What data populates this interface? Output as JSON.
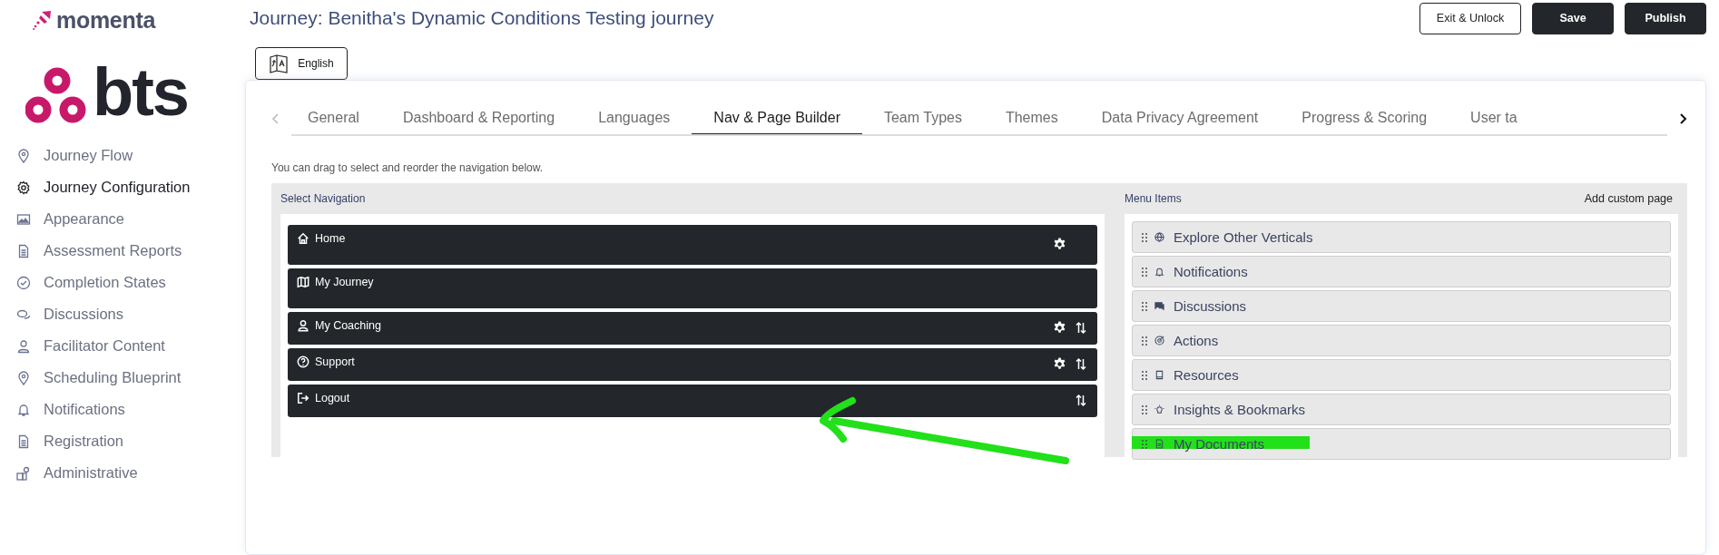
{
  "brand": {
    "product": "momenta",
    "client": "bts"
  },
  "sidebar": {
    "items": [
      {
        "label": "Journey Flow",
        "selected": false
      },
      {
        "label": "Journey Configuration",
        "selected": true
      },
      {
        "label": "Appearance",
        "selected": false
      },
      {
        "label": "Assessment Reports",
        "selected": false
      },
      {
        "label": "Completion States",
        "selected": false
      },
      {
        "label": "Discussions",
        "selected": false
      },
      {
        "label": "Facilitator Content",
        "selected": false
      },
      {
        "label": "Scheduling Blueprint",
        "selected": false
      },
      {
        "label": "Notifications",
        "selected": false
      },
      {
        "label": "Registration",
        "selected": false
      },
      {
        "label": "Administrative",
        "selected": false
      }
    ]
  },
  "header": {
    "title": "Journey: Benitha's Dynamic Conditions Testing journey",
    "buttons": [
      {
        "label": "Exit & Unlock",
        "kind": "outline"
      },
      {
        "label": "Save",
        "kind": "solid"
      },
      {
        "label": "Publish",
        "kind": "solid"
      }
    ]
  },
  "language_button": {
    "label": "English"
  },
  "tabs": [
    {
      "label": "General",
      "selected": false
    },
    {
      "label": "Dashboard & Reporting",
      "selected": false
    },
    {
      "label": "Languages",
      "selected": false
    },
    {
      "label": "Nav & Page Builder",
      "selected": true
    },
    {
      "label": "Team Types",
      "selected": false
    },
    {
      "label": "Themes",
      "selected": false
    },
    {
      "label": "Data Privacy Agreement",
      "selected": false
    },
    {
      "label": "Progress & Scoring",
      "selected": false
    },
    {
      "label": "User ta",
      "selected": false
    }
  ],
  "instruction": "You can drag to select and reorder the navigation below.",
  "select_navigation": {
    "title": "Select Navigation",
    "items": [
      {
        "label": "Home",
        "settings": true,
        "reorder": false,
        "tall": true
      },
      {
        "label": "My Journey",
        "settings": false,
        "reorder": false,
        "tall": true
      },
      {
        "label": "My Coaching",
        "settings": true,
        "reorder": true,
        "tall": false
      },
      {
        "label": "Support",
        "settings": true,
        "reorder": true,
        "tall": false
      },
      {
        "label": "Logout",
        "settings": false,
        "reorder": true,
        "tall": false
      }
    ]
  },
  "menu_items": {
    "title": "Menu Items",
    "action": "Add custom page",
    "items": [
      {
        "label": "Explore Other Verticals",
        "highlighted": false
      },
      {
        "label": "Notifications",
        "highlighted": false
      },
      {
        "label": "Discussions",
        "highlighted": false
      },
      {
        "label": "Actions",
        "highlighted": false
      },
      {
        "label": "Resources",
        "highlighted": false
      },
      {
        "label": "Insights & Bookmarks",
        "highlighted": false
      },
      {
        "label": "My Documents",
        "highlighted": true
      }
    ]
  }
}
